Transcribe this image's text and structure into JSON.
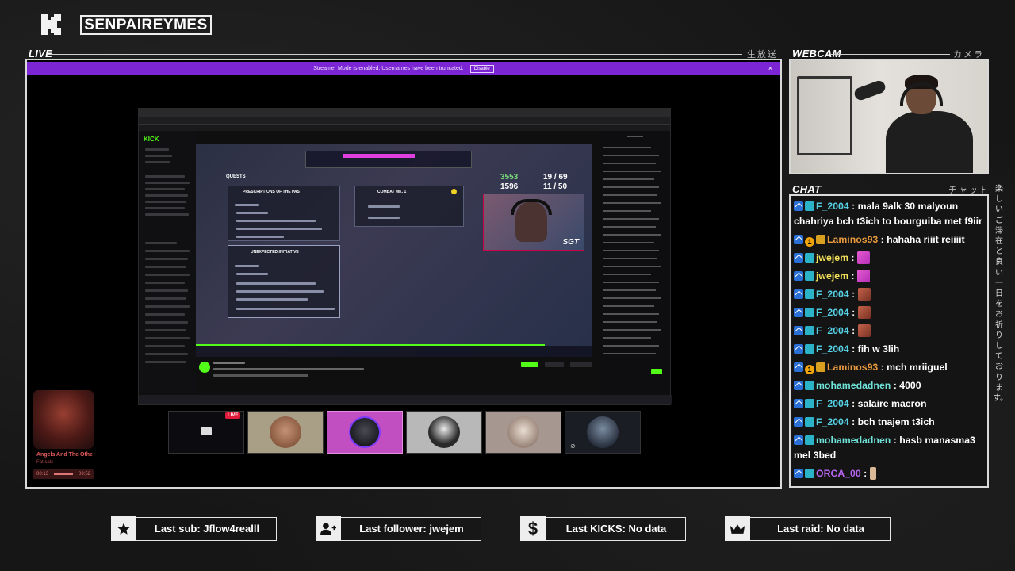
{
  "header": {
    "channel_name": "SENPAIREYMES"
  },
  "panels": {
    "live_label": "LIVE",
    "live_jp": "生放送",
    "webcam_label": "WEBCAM",
    "webcam_jp": "カメラ",
    "chat_label": "CHAT",
    "chat_jp": "チャット",
    "side_vertical_text": "楽しいご滞在と良い一日をお祈りしております。"
  },
  "stream": {
    "streamer_mode_text": "Streamer Mode is enabled. Usernames have been truncated.",
    "disable_label": "Disable",
    "close_glyph": "×",
    "live_badge": "LIVE",
    "score_primary": "3553",
    "score_secondary": "1596",
    "round_primary": "19 / 69",
    "round_secondary": "11 / 50",
    "quests_label": "QUESTS",
    "quest1_title": "PRESCRIPTIONS OF THE PAST",
    "quest2_title": "UNEXPECTED INITIATIVE",
    "quest3_title": "COMBAT MK. 1",
    "cam_tag": "SGT"
  },
  "now_playing": {
    "title": "Angels And The Othe",
    "artist": "Fat cats",
    "time_elapsed": "00:13",
    "time_total": "03:52"
  },
  "chat": {
    "messages": [
      {
        "badges": [
          "kick",
          "gift"
        ],
        "user": "F_2004",
        "user_color": "#56d1e6",
        "text": ": mala 9alk 30 malyoun chahriya bch t3ich to bourguiba met f9iir",
        "emote": ""
      },
      {
        "badges": [
          "kick",
          "num",
          "crown"
        ],
        "num": "1",
        "user": "Laminos93",
        "user_color": "#e89a3c",
        "text": ": hahaha riiit reiiiit",
        "emote": ""
      },
      {
        "badges": [
          "kick",
          "gift"
        ],
        "user": "jwejem",
        "user_color": "#f3e15a",
        "text": ": ",
        "emote": "flex"
      },
      {
        "badges": [
          "kick",
          "gift"
        ],
        "user": "jwejem",
        "user_color": "#f3e15a",
        "text": ": ",
        "emote": "flex"
      },
      {
        "badges": [
          "kick",
          "gift"
        ],
        "user": "F_2004",
        "user_color": "#56d1e6",
        "text": ": ",
        "emote": "photo"
      },
      {
        "badges": [
          "kick",
          "gift"
        ],
        "user": "F_2004",
        "user_color": "#56d1e6",
        "text": ": ",
        "emote": "photo"
      },
      {
        "badges": [
          "kick",
          "gift"
        ],
        "user": "F_2004",
        "user_color": "#56d1e6",
        "text": ": ",
        "emote": "photo"
      },
      {
        "badges": [
          "kick",
          "gift"
        ],
        "user": "F_2004",
        "user_color": "#56d1e6",
        "text": ": fih w 3lih",
        "emote": ""
      },
      {
        "badges": [
          "kick",
          "num",
          "crown"
        ],
        "num": "1",
        "user": "Laminos93",
        "user_color": "#e89a3c",
        "text": ": mch mriiguel",
        "emote": ""
      },
      {
        "badges": [
          "kick",
          "gift"
        ],
        "user": "mohamedadnen",
        "user_color": "#6fe3d9",
        "text": ": 4000",
        "emote": ""
      },
      {
        "badges": [
          "kick",
          "gift"
        ],
        "user": "F_2004",
        "user_color": "#56d1e6",
        "text": ": salaire macron",
        "emote": ""
      },
      {
        "badges": [
          "kick",
          "gift"
        ],
        "user": "F_2004",
        "user_color": "#56d1e6",
        "text": ": bch tnajem t3ich",
        "emote": ""
      },
      {
        "badges": [
          "kick",
          "gift"
        ],
        "user": "mohamedadnen",
        "user_color": "#6fe3d9",
        "text": ": hasb manasma3 mel 3bed",
        "emote": ""
      },
      {
        "badges": [
          "kick",
          "gift"
        ],
        "user": "ORCA_00",
        "user_color": "#b865f2",
        "text": ": ",
        "emote": "small"
      }
    ]
  },
  "footer": {
    "sub_label": "Last sub: Jflow4realll",
    "sub_icon": "star-icon",
    "follower_label": "Last follower: jwejem",
    "follower_icon": "add-user-icon",
    "kicks_label": "Last KICKS: No data",
    "kicks_icon": "dollar-icon",
    "kicks_glyph": "$",
    "raid_label": "Last raid: No data",
    "raid_icon": "crown-icon"
  },
  "colors": {
    "kick_green": "#53fc18",
    "streamer_bar": "#7b25d4",
    "frame": "#d9d9d9"
  }
}
